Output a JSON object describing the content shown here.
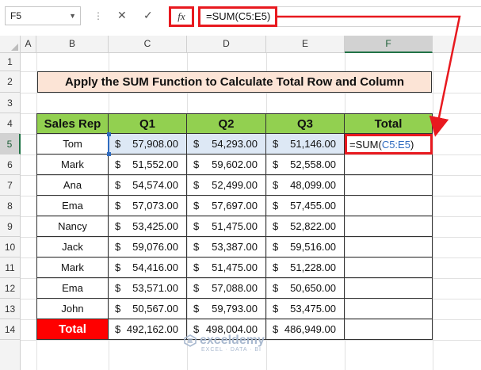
{
  "formula_bar": {
    "name_box": "F5",
    "fx_label": "fx",
    "formula": "=SUM(C5:E5)"
  },
  "columns": [
    "A",
    "B",
    "C",
    "D",
    "E",
    "F"
  ],
  "rows": [
    "1",
    "2",
    "3",
    "4",
    "5",
    "6",
    "7",
    "8",
    "9",
    "10",
    "11",
    "12",
    "13",
    "14"
  ],
  "title": "Apply the SUM Function to Calculate Total Row and Column",
  "table": {
    "headers": [
      "Sales Rep",
      "Q1",
      "Q2",
      "Q3",
      "Total"
    ],
    "currency": "$",
    "data": [
      {
        "rep": "Tom",
        "q1": "57,908.00",
        "q2": "54,293.00",
        "q3": "51,146.00"
      },
      {
        "rep": "Mark",
        "q1": "51,552.00",
        "q2": "59,602.00",
        "q3": "52,558.00"
      },
      {
        "rep": "Ana",
        "q1": "54,574.00",
        "q2": "52,499.00",
        "q3": "48,099.00"
      },
      {
        "rep": "Ema",
        "q1": "57,073.00",
        "q2": "57,697.00",
        "q3": "57,455.00"
      },
      {
        "rep": "Nancy",
        "q1": "53,425.00",
        "q2": "51,475.00",
        "q3": "52,822.00"
      },
      {
        "rep": "Jack",
        "q1": "59,076.00",
        "q2": "53,387.00",
        "q3": "59,516.00"
      },
      {
        "rep": "Mark",
        "q1": "54,416.00",
        "q2": "51,475.00",
        "q3": "51,228.00"
      },
      {
        "rep": "Ema",
        "q1": "53,571.00",
        "q2": "57,088.00",
        "q3": "50,650.00"
      },
      {
        "rep": "John",
        "q1": "50,567.00",
        "q2": "59,793.00",
        "q3": "53,475.00"
      }
    ],
    "total_label": "Total",
    "totals": {
      "q1": "492,162.00",
      "q2": "498,004.00",
      "q3": "486,949.00"
    },
    "active_cell": {
      "prefix": "=SUM(",
      "ref": "C5:E5",
      "suffix": ")"
    }
  },
  "watermark": {
    "name": "exceldemy",
    "tagline": "EXCEL · DATA · BI"
  },
  "colors": {
    "header_green": "#92d050",
    "title_fill": "#fce4d6",
    "total_red": "#ff0000",
    "highlight": "#e8191f",
    "selection_blue": "#dde8f5"
  }
}
